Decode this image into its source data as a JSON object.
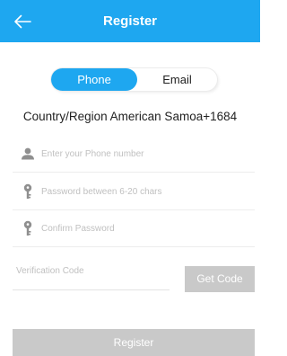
{
  "header": {
    "title": "Register",
    "back_icon": "arrow-left-icon"
  },
  "tabs": {
    "phone": "Phone",
    "email": "Email",
    "active": "phone"
  },
  "country": {
    "label": "Country/Region American Samoa+1684"
  },
  "fields": {
    "phone": {
      "placeholder": "Enter your Phone number",
      "icon": "user-icon"
    },
    "password": {
      "placeholder": "Password between 6-20 chars",
      "icon": "key-icon"
    },
    "confirm": {
      "placeholder": "Confirm Password",
      "icon": "key-icon"
    },
    "verification": {
      "placeholder": "Verification Code"
    }
  },
  "buttons": {
    "get_code": "Get Code",
    "register": "Register"
  },
  "colors": {
    "accent": "#1ea7f0",
    "disabled": "#c9c9c9"
  }
}
